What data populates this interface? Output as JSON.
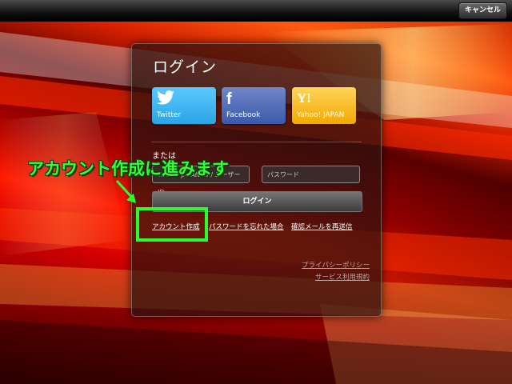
{
  "topbar": {
    "cancel_label": "キャンセル"
  },
  "panel": {
    "title": "ログイン",
    "social": [
      {
        "icon": "twitter-icon",
        "icon_glyph": "🐦",
        "label": "Twitter"
      },
      {
        "icon": "facebook-icon",
        "icon_glyph": "f",
        "label": "Facebook"
      },
      {
        "icon": "yahoo-icon",
        "icon_glyph": "Y!",
        "label": "Yahoo! JAPAN"
      }
    ],
    "or_label": "または",
    "id_placeholder": "Yahoo! JAPAN ID / ユーザーID",
    "password_placeholder": "パスワード",
    "login_label": "ログイン",
    "links": {
      "create_account": "アカウント作成",
      "forgot_password": "パスワードを忘れた場合",
      "resend_confirmation": "確認メールを再送信"
    },
    "footer": {
      "privacy": "プライバシーポリシー",
      "terms": "サービス利用規約"
    }
  },
  "annotation": {
    "callout": "アカウント作成に進みます",
    "color": "#2bff2b"
  }
}
